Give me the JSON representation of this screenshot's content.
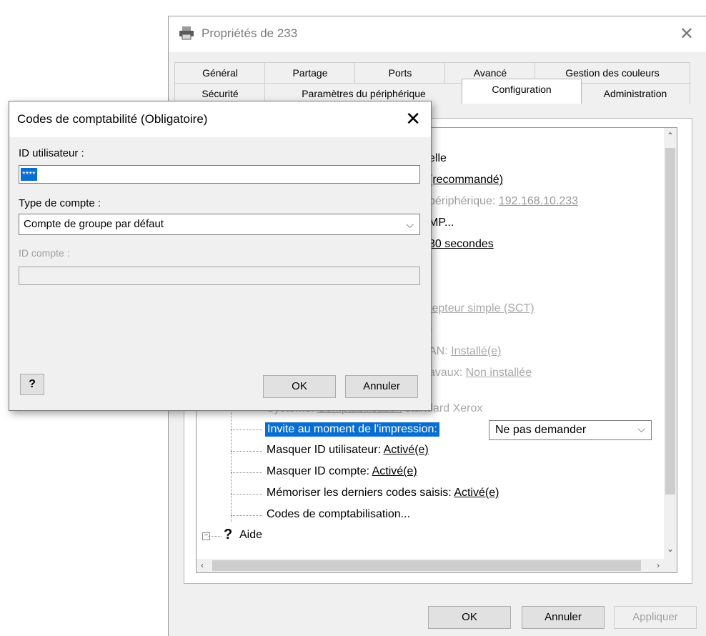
{
  "props_window": {
    "title": "Propriétés de 233",
    "tabs_row1": [
      "Général",
      "Partage",
      "Ports",
      "Avancé",
      "Gestion des couleurs"
    ],
    "tabs_row2": [
      "Sécurité",
      "Paramètres du périphérique",
      "Configuration",
      "Administration"
    ],
    "active_tab": "Configuration",
    "tree": {
      "r1": "elle",
      "r2": "(recommandé)",
      "r3_prefix": "périphérique: ",
      "r3_link": "192.168.10.233",
      "r4": "MP...",
      "r5": "30 secondes",
      "r6": "tepteur simple (SCT)",
      "r7": ")",
      "r8_prefix": "AN: ",
      "r8_link": "Installé(e)",
      "r9_prefix": "avaux: ",
      "r9_link": "Non installée",
      "systeme_prefix": "Système: ",
      "systeme_link": "Comptabilisation",
      "systeme_suffix": " standard Xerox",
      "invite_label": "Invite au moment de l'impression:",
      "invite_value": "Ne pas demander",
      "masquer_user_prefix": "Masquer ID utilisateur: ",
      "masquer_user_link": "Activé(e)",
      "masquer_compte_prefix": "Masquer ID compte: ",
      "masquer_compte_link": "Activé(e)",
      "memoriser_prefix": "Mémoriser les derniers codes saisis: ",
      "memoriser_link": "Activé(e)",
      "codes": "Codes de comptabilisation...",
      "aide": "Aide"
    },
    "buttons": {
      "ok": "OK",
      "cancel": "Annuler",
      "apply": "Appliquer"
    }
  },
  "dialog": {
    "title": "Codes de comptabilité (Obligatoire)",
    "user_id_label": "ID utilisateur :",
    "user_id_value": "****",
    "account_type_label": "Type de compte :",
    "account_type_value": "Compte de groupe par défaut",
    "account_id_label": "ID compte :",
    "account_id_value": "",
    "help_button": "?",
    "ok": "OK",
    "cancel": "Annuler"
  },
  "colors": {
    "selection": "#0a6ed1",
    "dialog_bg": "#f0f0f0"
  }
}
